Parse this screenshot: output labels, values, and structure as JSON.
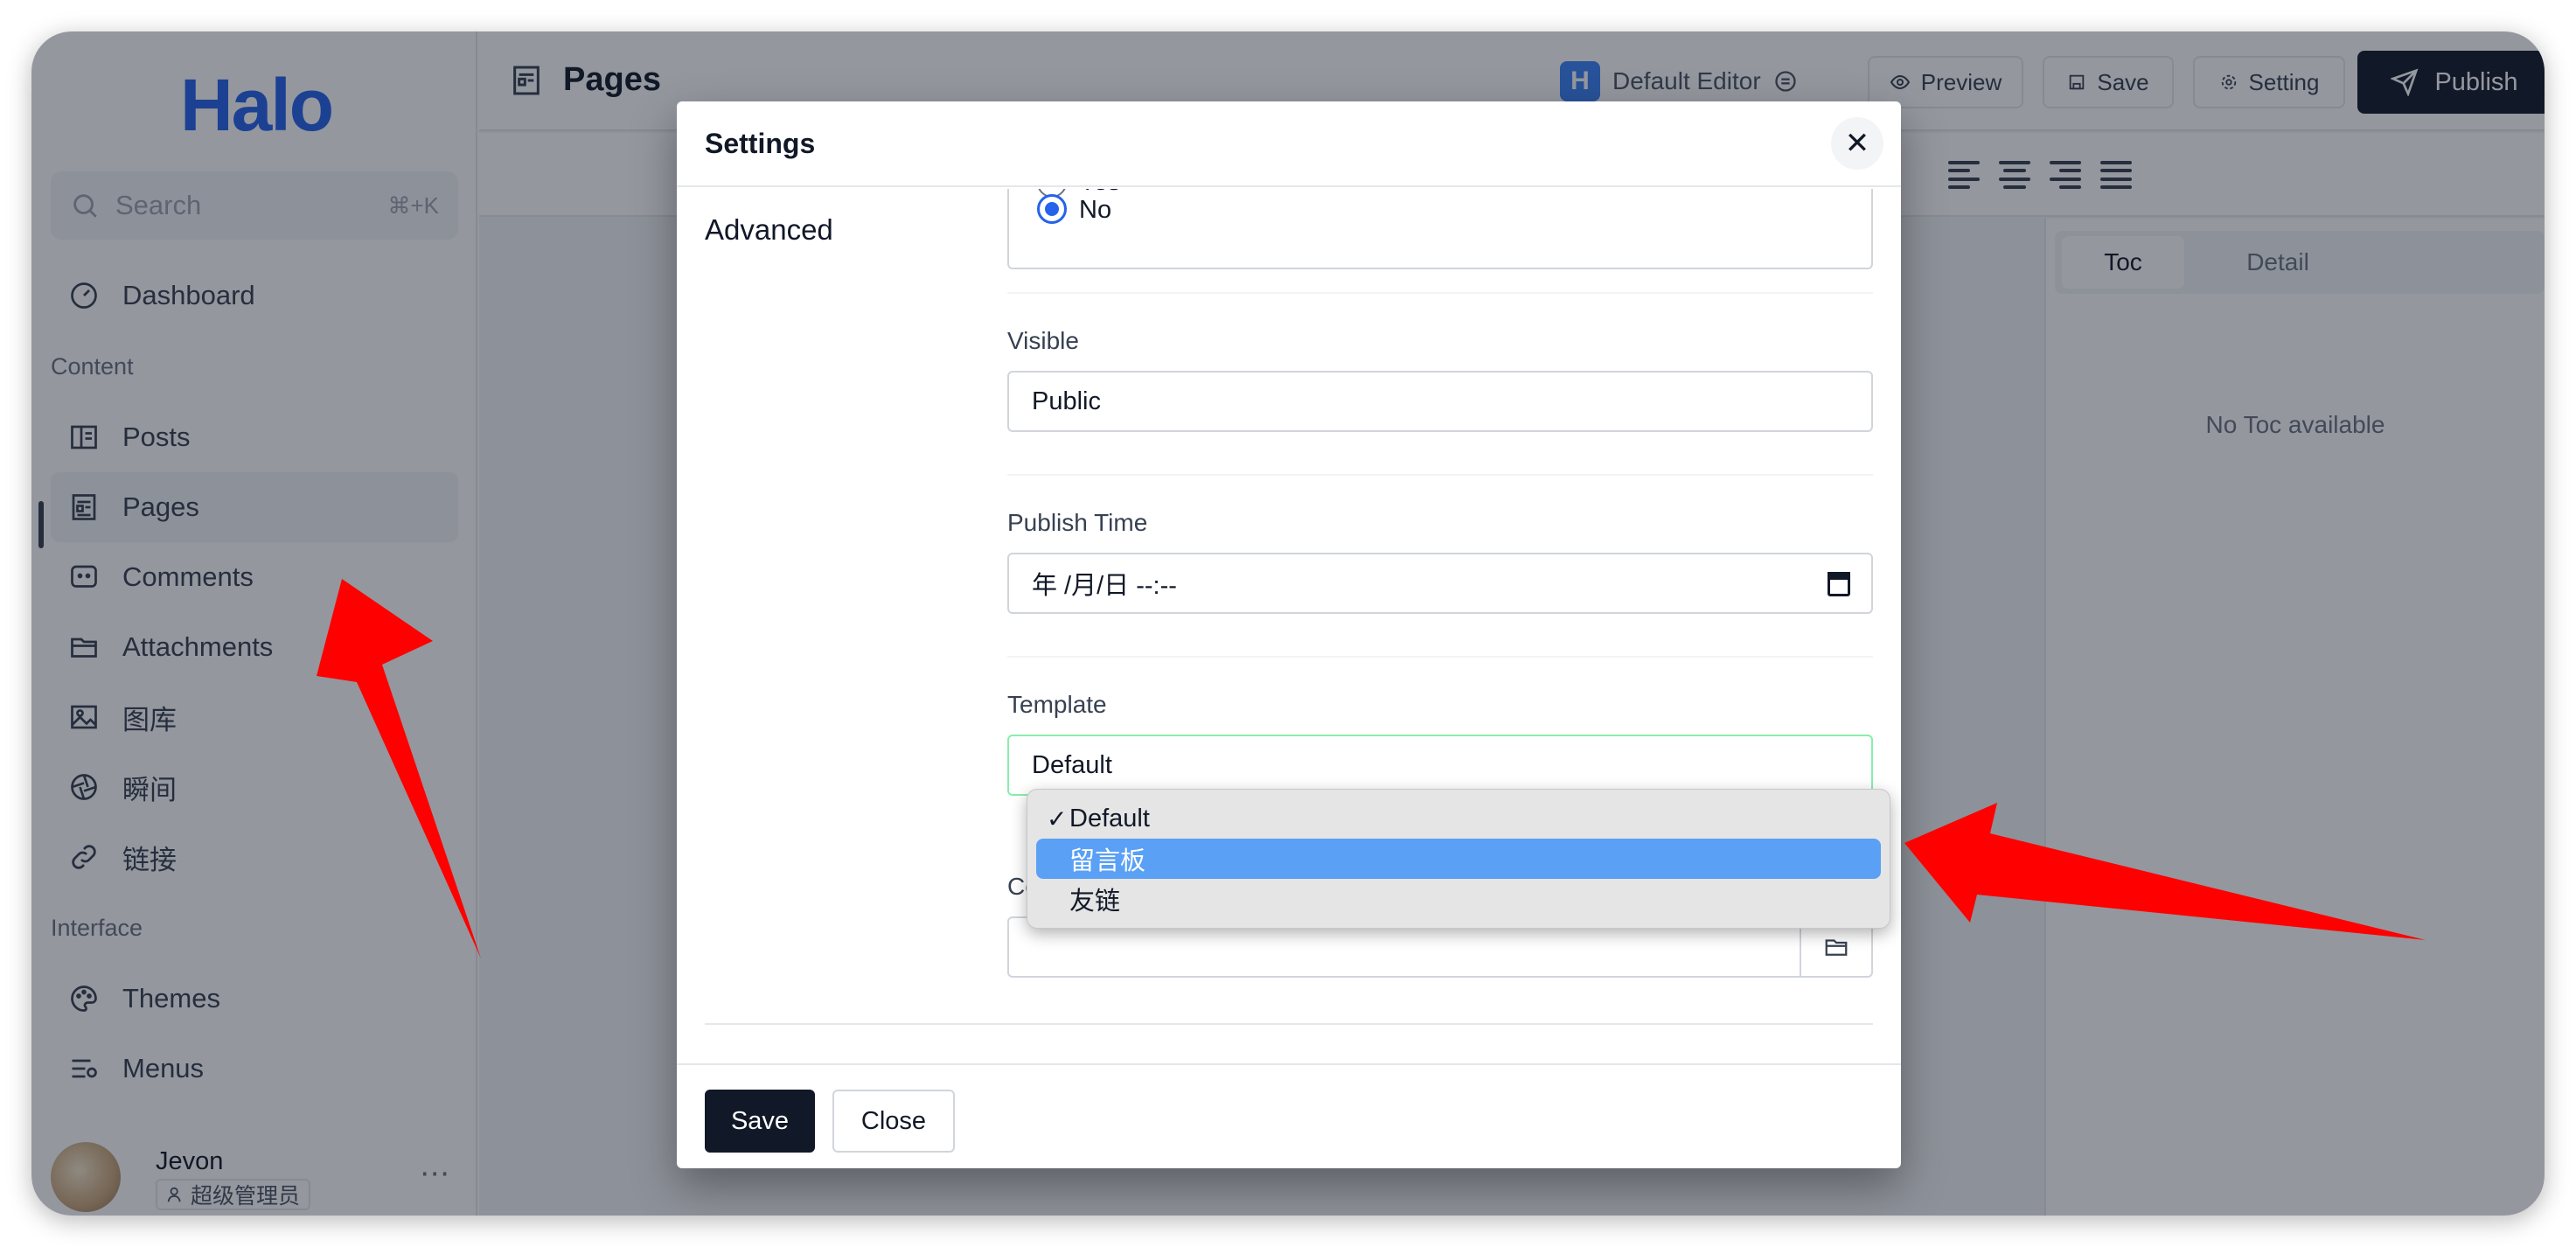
{
  "sidebar": {
    "logo": "Halo",
    "search": {
      "placeholder": "Search",
      "shortcut": "⌘+K"
    },
    "items": [
      {
        "label": "Dashboard",
        "icon": "dashboard-icon"
      },
      {
        "label": "Posts",
        "icon": "book-icon"
      },
      {
        "label": "Pages",
        "icon": "page-icon"
      },
      {
        "label": "Comments",
        "icon": "comment-icon"
      },
      {
        "label": "Attachments",
        "icon": "folder-icon"
      },
      {
        "label": "图库",
        "icon": "image-icon"
      },
      {
        "label": "瞬间",
        "icon": "aperture-icon"
      },
      {
        "label": "链接",
        "icon": "link-icon"
      },
      {
        "label": "Themes",
        "icon": "palette-icon"
      },
      {
        "label": "Menus",
        "icon": "menu-icon"
      }
    ],
    "groups": {
      "content": "Content",
      "interface": "Interface"
    },
    "active_item": "Pages",
    "user": {
      "name": "Jevon",
      "role": "超级管理员"
    }
  },
  "header": {
    "title": "Pages",
    "editor": {
      "badge": "H",
      "label": "Default Editor"
    },
    "buttons": {
      "preview": "Preview",
      "save": "Save",
      "setting": "Setting",
      "publish": "Publish"
    }
  },
  "right_panel": {
    "tabs": [
      "Toc",
      "Detail"
    ],
    "empty_text": "No Toc available"
  },
  "modal": {
    "title": "Settings",
    "section": "Advanced",
    "radio": [
      {
        "label": "Yes",
        "checked": false
      },
      {
        "label": "No",
        "checked": true
      }
    ],
    "fields": {
      "visible": {
        "label": "Visible",
        "value": "Public"
      },
      "publish_time": {
        "label": "Publish Time",
        "value": "年 /月/日 --:--"
      },
      "template": {
        "label": "Template",
        "value": "Default"
      },
      "cover": {
        "label": "Cover",
        "value": ""
      }
    },
    "footer": {
      "save": "Save",
      "close": "Close"
    }
  },
  "dropdown": {
    "options": [
      {
        "label": "Default",
        "checked": true,
        "highlighted": false
      },
      {
        "label": "留言板",
        "checked": false,
        "highlighted": true
      },
      {
        "label": "友链",
        "checked": false,
        "highlighted": false
      }
    ]
  },
  "colors": {
    "accent": "#2563eb",
    "dark": "#111827",
    "highlight": "#5aa0f5",
    "annotation": "#ff0000"
  }
}
